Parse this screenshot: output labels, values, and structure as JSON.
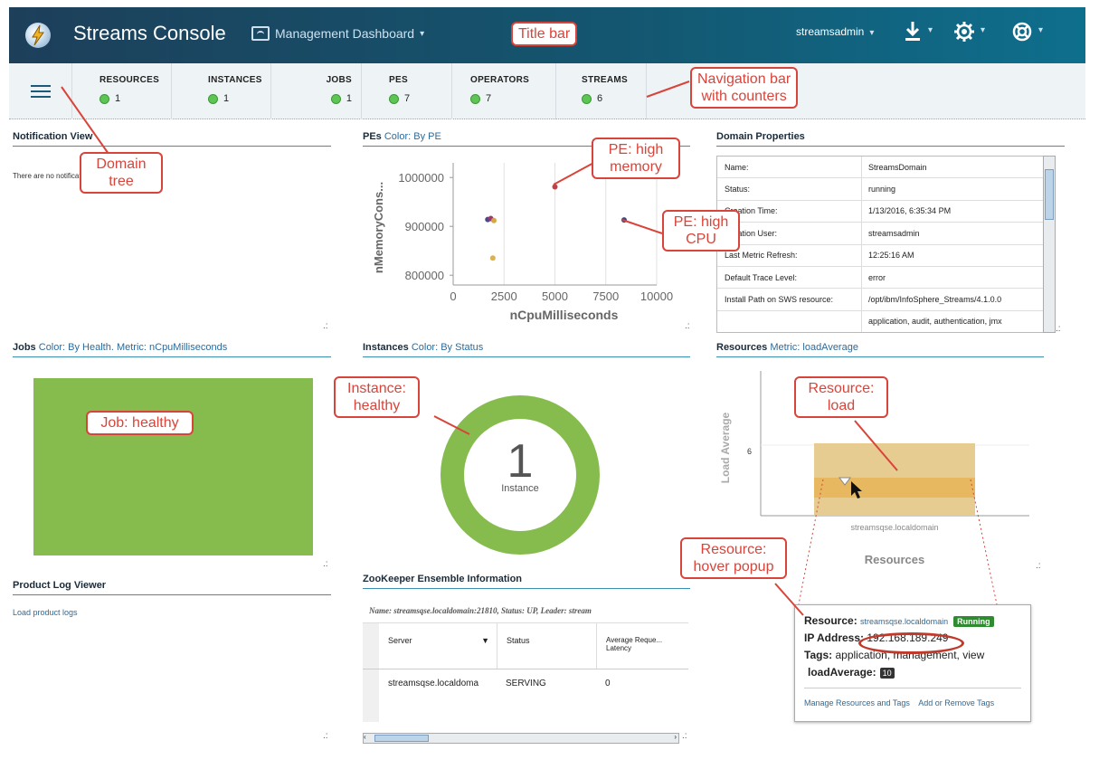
{
  "title_bar": {
    "app_title": "Streams Console",
    "dashboard_label": "Management Dashboard",
    "dashboard_caret": "▾",
    "user": "streamsadmin",
    "caret": "▾"
  },
  "navbar": {
    "items": [
      {
        "label": "RESOURCES",
        "count": "1"
      },
      {
        "label": "INSTANCES",
        "count": "1"
      },
      {
        "label": "JOBS",
        "count": "1"
      },
      {
        "label": "PES",
        "count": "7"
      },
      {
        "label": "OPERATORS",
        "count": "7"
      },
      {
        "label": "STREAMS",
        "count": "6"
      }
    ]
  },
  "notification": {
    "title": "Notification View",
    "message": "There are no notifications for the domain."
  },
  "pes_chart": {
    "title": "PEs",
    "subtitle": "Color: By PE",
    "ylabel": "nMemoryCons...",
    "xlabel": "nCpuMilliseconds"
  },
  "chart_data": {
    "type": "scatter",
    "title": "PEs",
    "xlabel": "nCpuMilliseconds",
    "ylabel": "nMemoryCons...",
    "xlim": [
      0,
      10000
    ],
    "ylim": [
      780000,
      1030000
    ],
    "x_ticks": [
      "0",
      "2500",
      "5000",
      "7500",
      "10000"
    ],
    "y_ticks": [
      "800000",
      "900000",
      "1000000"
    ],
    "points": [
      {
        "x": 1700,
        "y": 914000,
        "color": "#4a4a8a"
      },
      {
        "x": 1850,
        "y": 916000,
        "color": "#9a3a6a"
      },
      {
        "x": 2000,
        "y": 912000,
        "color": "#d6a640"
      },
      {
        "x": 1950,
        "y": 835000,
        "color": "#e0b050"
      },
      {
        "x": 5000,
        "y": 981000,
        "color": "#c0404a"
      },
      {
        "x": 8400,
        "y": 913000,
        "color": "#3a4a8a"
      }
    ]
  },
  "domain_props": {
    "title": "Domain Properties",
    "rows": [
      {
        "k": "Name:",
        "v": "StreamsDomain"
      },
      {
        "k": "Status:",
        "v": "running"
      },
      {
        "k": "Creation Time:",
        "v": "1/13/2016, 6:35:34 PM"
      },
      {
        "k": "Creation User:",
        "v": "streamsadmin"
      },
      {
        "k": "Last Metric Refresh:",
        "v": "12:25:16 AM"
      },
      {
        "k": "Default Trace Level:",
        "v": "error"
      },
      {
        "k": "Install Path on SWS resource:",
        "v": "/opt/ibm/InfoSphere_Streams/4.1.0.0"
      },
      {
        "k": "",
        "v": "application, audit, authentication, jmx"
      }
    ]
  },
  "jobs": {
    "title": "Jobs",
    "subtitle": "Color: By Health. Metric: nCpuMilliseconds",
    "color": "#86bc4e"
  },
  "instances": {
    "title": "Instances",
    "subtitle": "Color: By Status",
    "count": "1",
    "label": "Instance",
    "color": "#86bc4e"
  },
  "resources": {
    "title": "Resources",
    "subtitle": "Metric: loadAverage",
    "ylabel": "Load Average",
    "ytick": "6",
    "xtick": "streamsqse.localdomain",
    "xlabel": "Resources"
  },
  "product_log": {
    "title": "Product Log Viewer",
    "link": "Load product logs"
  },
  "zookeeper": {
    "title": "ZooKeeper Ensemble Information",
    "summary": "Name: streamsqse.localdomain:21810, Status: UP, Leader: stream",
    "columns": [
      "Server",
      "Status",
      "Average Reque... Latency"
    ],
    "rows": [
      {
        "server": "streamsqse.localdoma",
        "status": "SERVING",
        "latency": "0"
      }
    ]
  },
  "popup": {
    "resource_label": "Resource:",
    "resource_value": "streamsqse.localdomain",
    "status": "Running",
    "ip_label": "IP Address:",
    "ip_value": "192.168.189.249",
    "tags_label": "Tags:",
    "tags_value": "application, management, view",
    "metric_label": "loadAverage:",
    "metric_value": "10",
    "link1": "Manage Resources and Tags",
    "link2": "Add or Remove Tags"
  },
  "callouts": {
    "title_bar": "Title bar",
    "navigation": "Navigation bar\nwith counters",
    "domain_tree": "Domain\ntree",
    "pe_memory": "PE: high\nmemory",
    "pe_cpu": "PE: high\nCPU",
    "instance": "Instance:\nhealthy",
    "job": "Job: healthy",
    "resource_load": "Resource:\nload",
    "resource_popup": "Resource:\nhover popup"
  },
  "colors": {
    "accent": "#1d5a7a",
    "healthy": "#86bc4e",
    "callout": "#d9443a"
  }
}
